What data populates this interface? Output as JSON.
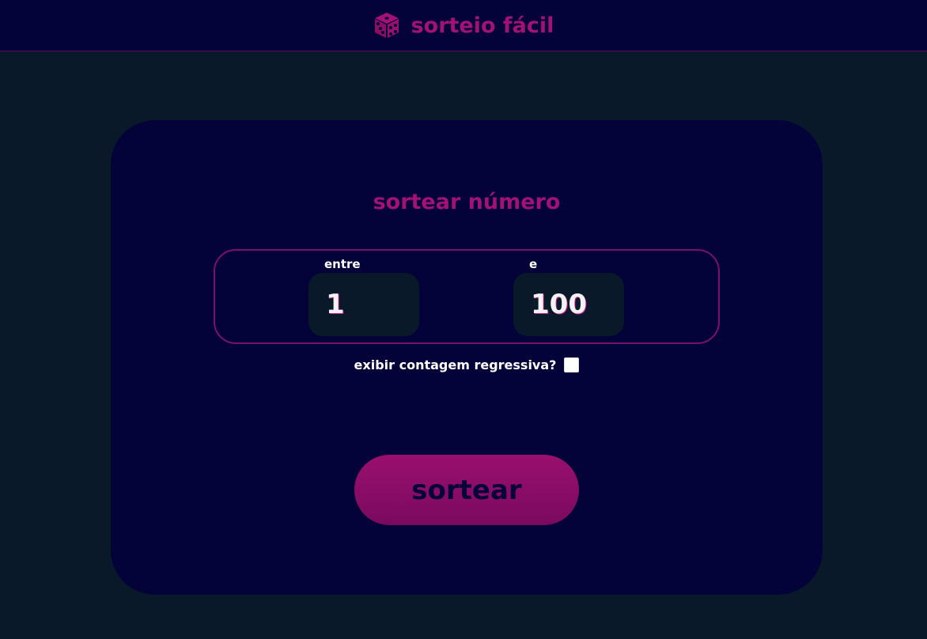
{
  "header": {
    "logo_icon": "dice-icon",
    "brand": "sorteio fácil"
  },
  "card": {
    "title": "sortear número",
    "range": {
      "from_label": "entre",
      "from_value": "1",
      "to_label": "e",
      "to_value": "100"
    },
    "countdown": {
      "label": "exibir contagem regressiva?",
      "checked": false
    },
    "draw_button_label": "sortear"
  },
  "colors": {
    "background": "#0a1929",
    "panel": "#03033a",
    "accent": "#a21175",
    "text": "#ffffff"
  }
}
